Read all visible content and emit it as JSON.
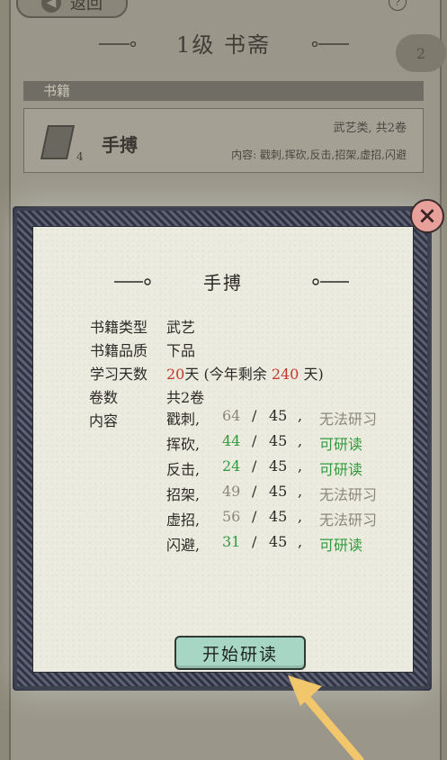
{
  "background": {
    "back_label": "返回",
    "help_icon": "?",
    "title": "1级 书斋",
    "cloud_text": "2",
    "section_label": "书籍",
    "card": {
      "count": "4",
      "name": "手搏",
      "type_line": "武艺类, 共2卷",
      "content_line": "内容: 戳刺,挥砍,反击,招架,虚招,闪避"
    }
  },
  "modal": {
    "title": "手搏",
    "close_icon": "×",
    "rows": [
      {
        "label": "书籍类型",
        "value": "武艺"
      },
      {
        "label": "书籍品质",
        "value": "下品"
      }
    ],
    "study_days": {
      "label": "学习天数",
      "days": "20",
      "unit": "天",
      "remaining_prefix": "(今年剩余",
      "remaining_value": "240",
      "remaining_suffix": "天)"
    },
    "volumes": {
      "label": "卷数",
      "value": "共2卷"
    },
    "content_label": "内容",
    "skills": [
      {
        "name": "戳刺,",
        "current": "64",
        "required": "45",
        "status": "无法研习",
        "can_study": false
      },
      {
        "name": "挥砍,",
        "current": "44",
        "required": "45",
        "status": "可研读",
        "can_study": true
      },
      {
        "name": "反击,",
        "current": "24",
        "required": "45",
        "status": "可研读",
        "can_study": true
      },
      {
        "name": "招架,",
        "current": "49",
        "required": "45",
        "status": "无法研习",
        "can_study": false
      },
      {
        "name": "虚招,",
        "current": "56",
        "required": "45",
        "status": "无法研习",
        "can_study": false
      },
      {
        "name": "闪避,",
        "current": "31",
        "required": "45",
        "status": "可研读",
        "can_study": true
      }
    ],
    "slash": "/",
    "comma": ",",
    "start_button": "开始研读"
  },
  "colors": {
    "highlight_red": "#c0392b",
    "studyable_green": "#2e9b3e",
    "disabled_gray": "#8a877d",
    "button_mint": "#a8d6c5",
    "close_pink": "#e8a09a",
    "arrow_yellow": "#f2c66a"
  }
}
